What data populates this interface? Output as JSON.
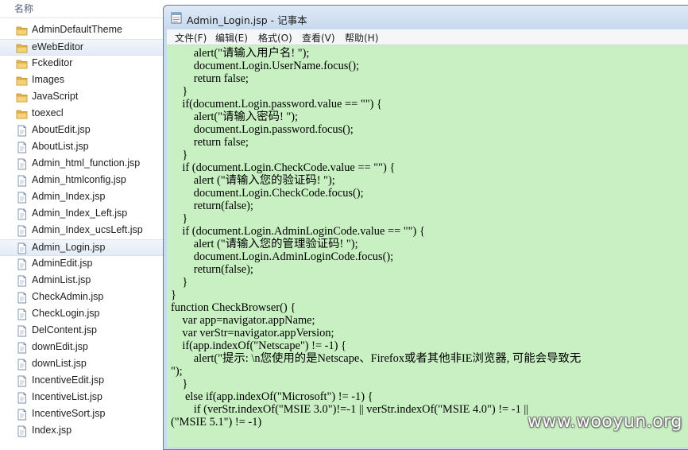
{
  "explorer": {
    "column_header": "名称",
    "items": [
      {
        "label": "AdminDefaultTheme",
        "type": "folder"
      },
      {
        "label": "eWebEditor",
        "type": "folder",
        "selected": true
      },
      {
        "label": "Fckeditor",
        "type": "folder"
      },
      {
        "label": "Images",
        "type": "folder"
      },
      {
        "label": "JavaScript",
        "type": "folder"
      },
      {
        "label": "toexecl",
        "type": "folder"
      },
      {
        "label": "AboutEdit.jsp",
        "type": "file"
      },
      {
        "label": "AboutList.jsp",
        "type": "file"
      },
      {
        "label": "Admin_html_function.jsp",
        "type": "file"
      },
      {
        "label": "Admin_htmlconfig.jsp",
        "type": "file"
      },
      {
        "label": "Admin_Index.jsp",
        "type": "file"
      },
      {
        "label": "Admin_Index_Left.jsp",
        "type": "file"
      },
      {
        "label": "Admin_Index_ucsLeft.jsp",
        "type": "file"
      },
      {
        "label": "Admin_Login.jsp",
        "type": "file",
        "selected": true
      },
      {
        "label": "AdminEdit.jsp",
        "type": "file"
      },
      {
        "label": "AdminList.jsp",
        "type": "file"
      },
      {
        "label": "CheckAdmin.jsp",
        "type": "file"
      },
      {
        "label": "CheckLogin.jsp",
        "type": "file"
      },
      {
        "label": "DelContent.jsp",
        "type": "file"
      },
      {
        "label": "downEdit.jsp",
        "type": "file"
      },
      {
        "label": "downList.jsp",
        "type": "file"
      },
      {
        "label": "IncentiveEdit.jsp",
        "type": "file"
      },
      {
        "label": "IncentiveList.jsp",
        "type": "file"
      },
      {
        "label": "IncentiveSort.jsp",
        "type": "file"
      },
      {
        "label": "Index.jsp",
        "type": "file"
      }
    ]
  },
  "notepad": {
    "title": "Admin_Login.jsp - 记事本",
    "menu": [
      {
        "label": "文件(F)",
        "name": "menu-file"
      },
      {
        "label": "编辑(E)",
        "name": "menu-edit"
      },
      {
        "label": "格式(O)",
        "name": "menu-format"
      },
      {
        "label": "查看(V)",
        "name": "menu-view"
      },
      {
        "label": "帮助(H)",
        "name": "menu-help"
      }
    ],
    "code_lines": [
      "        alert(\"请输入用户名! \");",
      "        document.Login.UserName.focus();",
      "        return false;",
      "    }",
      "    if(document.Login.password.value == \"\") {",
      "        alert(\"请输入密码! \");",
      "        document.Login.password.focus();",
      "        return false;",
      "    }",
      "    if (document.Login.CheckCode.value == \"\") {",
      "        alert (\"请输入您的验证码! \");",
      "        document.Login.CheckCode.focus();",
      "        return(false);",
      "    }",
      "    if (document.Login.AdminLoginCode.value == \"\") {",
      "        alert (\"请输入您的管理验证码! \");",
      "        document.Login.AdminLoginCode.focus();",
      "        return(false);",
      "    }",
      "}",
      "function CheckBrowser() {",
      "    var app=navigator.appName;",
      "    var verStr=navigator.appVersion;",
      "    if(app.indexOf(\"Netscape\") != -1) {",
      "        alert(\"提示: \\n您使用的是Netscape、Firefox或者其他非IE浏览器, 可能会导致无",
      "\");",
      "    }",
      "     else if(app.indexOf(\"Microsoft\") != -1) {",
      "        if (verStr.indexOf(\"MSIE 3.0\")!=-1 || verStr.indexOf(\"MSIE 4.0\") != -1 ||",
      "(\"MSIE 5.1\") != -1)"
    ],
    "editor_background": "#c8f0c2"
  },
  "watermark": "www.wooyun.org"
}
